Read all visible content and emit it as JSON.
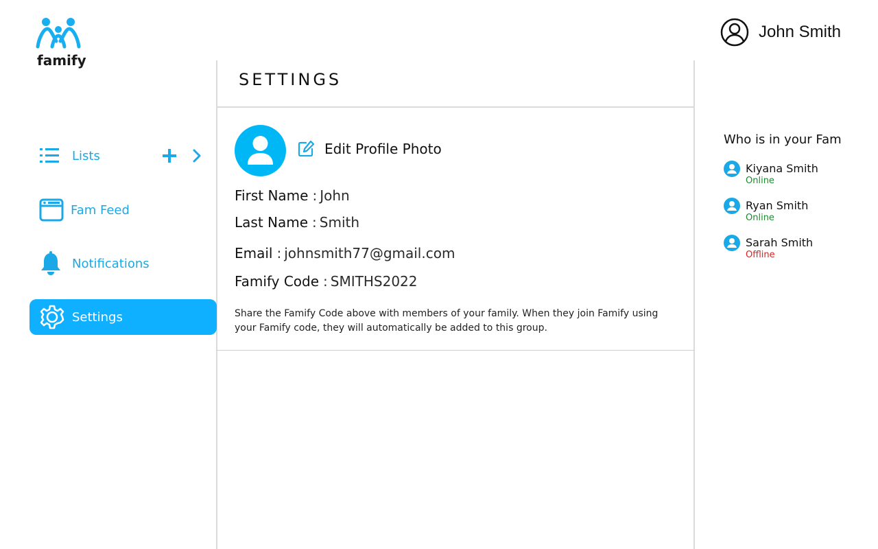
{
  "app": {
    "logo_text": "famify",
    "brand_color": "#0fb0ff"
  },
  "header": {
    "user_name": "John Smith",
    "user_icon": "user-circle-icon"
  },
  "sidebar": {
    "items": [
      {
        "label": "Lists",
        "icon": "list-icon",
        "actions": [
          "plus-icon",
          "chevron-right-icon"
        ]
      },
      {
        "label": "Fam Feed",
        "icon": "browser-window-icon"
      },
      {
        "label": "Notifications",
        "icon": "bell-icon"
      },
      {
        "label": "Settings",
        "icon": "gear-icon",
        "active": true
      }
    ]
  },
  "settings": {
    "title": "SETTINGS",
    "edit_photo_label": "Edit Profile Photo",
    "fields": [
      {
        "label": "First Name",
        "value": "John"
      },
      {
        "label": "Last Name",
        "value": "Smith"
      },
      {
        "label": "Email",
        "value": "johnsmith77@gmail.com"
      },
      {
        "label": "Famify Code",
        "value": "SMITHS2022"
      }
    ],
    "separator": ":",
    "note": "Share the Famify Code above with members of your family. When they join Famify using your Famify code, they will automatically be added to this group."
  },
  "fam": {
    "title": "Who is in your Fam",
    "members": [
      {
        "name": "Kiyana Smith",
        "status": "Online",
        "status_color": "#1a8a2e"
      },
      {
        "name": "Ryan Smith",
        "status": "Online",
        "status_color": "#1a8a2e"
      },
      {
        "name": "Sarah Smith",
        "status": "Offline",
        "status_color": "#e02020"
      }
    ]
  }
}
